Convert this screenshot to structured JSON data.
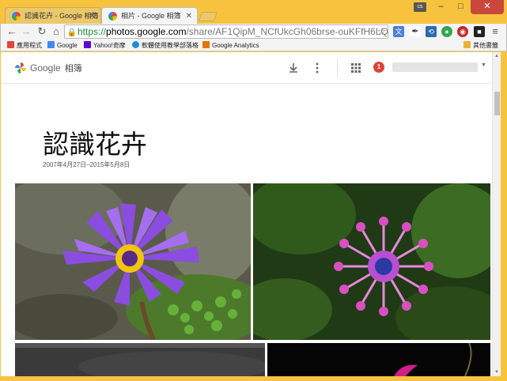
{
  "browser": {
    "tabs": [
      {
        "title": "認識花卉 - Google 相簿",
        "active": false
      },
      {
        "title": "相片 - Google 相簿",
        "active": true
      }
    ],
    "user_badge": "cs",
    "window_buttons": {
      "minimize": "–",
      "maximize": "□",
      "close": "✕"
    },
    "url": {
      "scheme": "https://",
      "host": "photos.google.com",
      "path": "/share/AF1QipM_NCfUkcGh06brse-ouKFfH6LQKGbjY"
    },
    "bookmarks": [
      {
        "label": "應用程式",
        "icon": "apps-grid-icon",
        "color": "#e8453c"
      },
      {
        "label": "Google",
        "icon": "google-g-icon",
        "color": "#4285f4"
      },
      {
        "label": "Yahoo!奇摩",
        "icon": "yahoo-icon",
        "color": "#5f01d1"
      },
      {
        "label": "軟體使用教學部落格",
        "icon": "blog-icon",
        "color": "#1f8ed8"
      },
      {
        "label": "Google Analytics",
        "icon": "analytics-icon",
        "color": "#e37400"
      }
    ],
    "other_bookmarks": "其他書籤"
  },
  "photos_app": {
    "logo_text": "Google",
    "logo_sub": "相簿",
    "icons": [
      "download-icon",
      "more-vert-icon",
      "apps-icon"
    ],
    "notification_count": "1"
  },
  "album": {
    "title": "認識花卉",
    "date_range": "2007年4月27日–2015年5月8日"
  },
  "colors": {
    "frame": "#f7c33f",
    "accent_red": "#db4437"
  }
}
